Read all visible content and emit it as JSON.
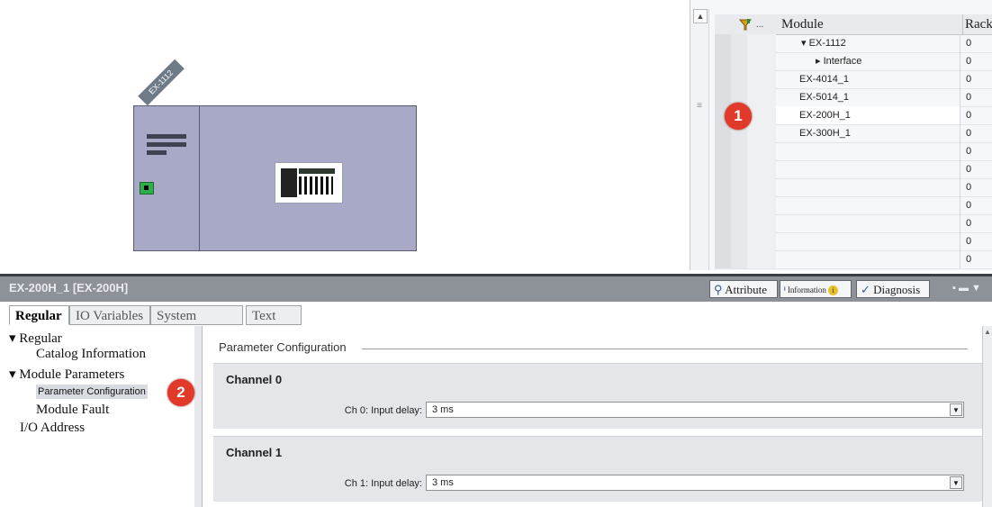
{
  "device_view": {
    "device_label": "EX-1112"
  },
  "overview": {
    "headers": {
      "icon_col": "...",
      "module": "Module",
      "rack": "Rack"
    },
    "rows": [
      {
        "name": "▾ EX-1112",
        "rack": "0"
      },
      {
        "name": "▸ Interface",
        "rack": "0"
      },
      {
        "name": "EX-4014_1",
        "rack": "0"
      },
      {
        "name": "EX-5014_1",
        "rack": "0"
      },
      {
        "name": "EX-200H_1",
        "rack": "0"
      },
      {
        "name": "EX-300H_1",
        "rack": "0"
      },
      {
        "name": "",
        "rack": "0"
      },
      {
        "name": "",
        "rack": "0"
      },
      {
        "name": "",
        "rack": "0"
      },
      {
        "name": "",
        "rack": "0"
      },
      {
        "name": "",
        "rack": "0"
      },
      {
        "name": "",
        "rack": "0"
      },
      {
        "name": "",
        "rack": "0"
      }
    ],
    "selected_row": "EX-200H_1"
  },
  "badges": {
    "one": "1",
    "two": "2"
  },
  "inspector": {
    "title": "EX-200H_1 [EX-200H]",
    "tabs_right": {
      "attribute": "Attribute",
      "information": "Information",
      "diagnosis": "Diagnosis"
    }
  },
  "tabs": [
    "Regular",
    "IO Variables",
    "System Constant",
    "Text"
  ],
  "nav": {
    "items": [
      {
        "label": "▾ Regular"
      },
      {
        "label": "Catalog Information"
      },
      {
        "label": "▾ Module Parameters"
      },
      {
        "label": "Parameter Configuration"
      },
      {
        "label": "Module Fault"
      },
      {
        "label": "I/O Address"
      }
    ]
  },
  "content": {
    "section_title": "Parameter Configuration",
    "channels": [
      {
        "title": "Channel 0",
        "label": "Ch 0: Input delay:",
        "value": "3 ms"
      },
      {
        "title": "Channel 1",
        "label": "Ch 1: Input delay:",
        "value": "3 ms"
      }
    ]
  },
  "colors": {
    "badge": "#e23a2a",
    "station": "#a7a9c7",
    "inspector_bar": "#8d9198"
  }
}
